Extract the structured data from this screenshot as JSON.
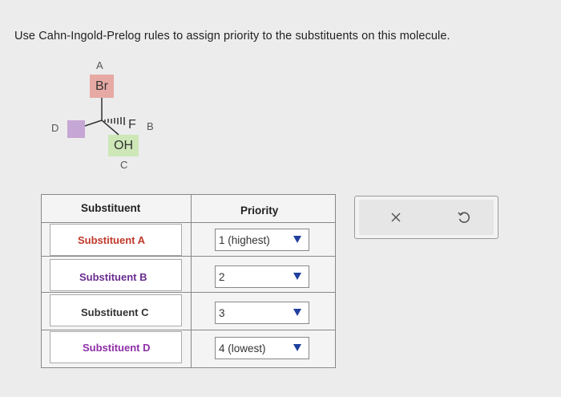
{
  "question": "Use Cahn-Ingold-Prelog rules to assign priority to the substituents on this molecule.",
  "molecule": {
    "label_a": "A",
    "label_b": "B",
    "label_c": "C",
    "label_d": "D",
    "br": "Br",
    "f": "F",
    "oh": "OH"
  },
  "table": {
    "header_substituent": "Substituent",
    "header_priority": "Priority",
    "rows": [
      {
        "label": "Substituent A",
        "color": "#c0392b",
        "priority": "1 (highest)"
      },
      {
        "label": "Substituent B",
        "color": "#6a2c8f",
        "priority": "2"
      },
      {
        "label": "Substituent C",
        "color": "#333333",
        "priority": "3"
      },
      {
        "label": "Substituent D",
        "color": "#8e2fa8",
        "priority": "4 (lowest)"
      }
    ]
  },
  "actions": {
    "close_icon": "close-icon",
    "undo_icon": "undo-icon"
  },
  "colors": {
    "dropdown_arrow": "#1f3f9e"
  }
}
